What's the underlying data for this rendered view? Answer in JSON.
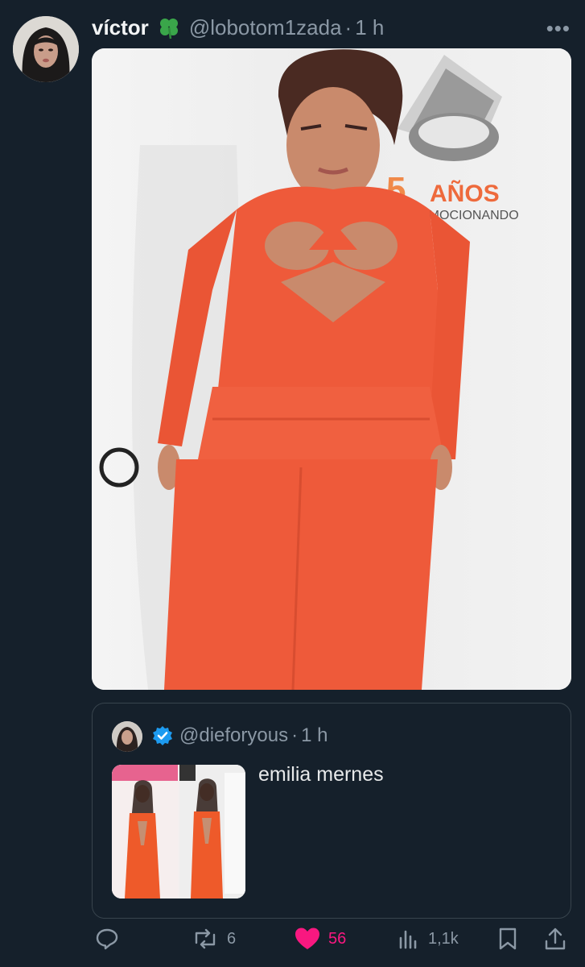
{
  "tweet": {
    "author_name": "víctor",
    "author_handle": "@lobotom1zada",
    "separator": "·",
    "time": "1 h",
    "more_label": "•••",
    "name_emoji": "clover-icon"
  },
  "media": {
    "sign_text": "AÑOS",
    "sign_number": "5",
    "sign_subtext": "EMOCIONANDO",
    "dress_color": "#ee5a3a"
  },
  "quoted_tweet": {
    "handle": "@dieforyous",
    "separator": "·",
    "time": "1 h",
    "text": "emilia mernes",
    "verified_icon": "verified-badge-icon"
  },
  "actions": {
    "reply_count": "",
    "retweet_count": "6",
    "like_count": "56",
    "views_count": "1,1k"
  },
  "colors": {
    "background": "#15202b",
    "secondary_text": "#8b98a5",
    "like": "#f91880",
    "verified": "#1d9bf0"
  }
}
